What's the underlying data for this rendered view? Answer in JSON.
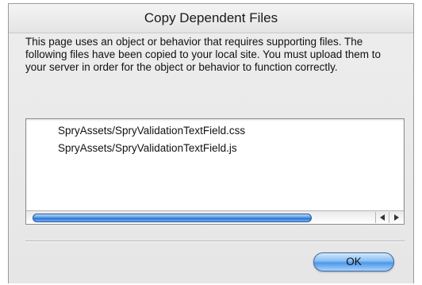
{
  "dialog": {
    "title": "Copy Dependent Files",
    "message": "This page uses an object or behavior that requires supporting files. The following files have been copied to your local site. You must upload them to your server in order for the object or behavior to function correctly.",
    "files": [
      "SpryAssets/SpryValidationTextField.css",
      "SpryAssets/SpryValidationTextField.js"
    ],
    "ok_label": "OK"
  },
  "colors": {
    "accent": "#4b98ea",
    "dialog_background": "#e8e8e8"
  }
}
